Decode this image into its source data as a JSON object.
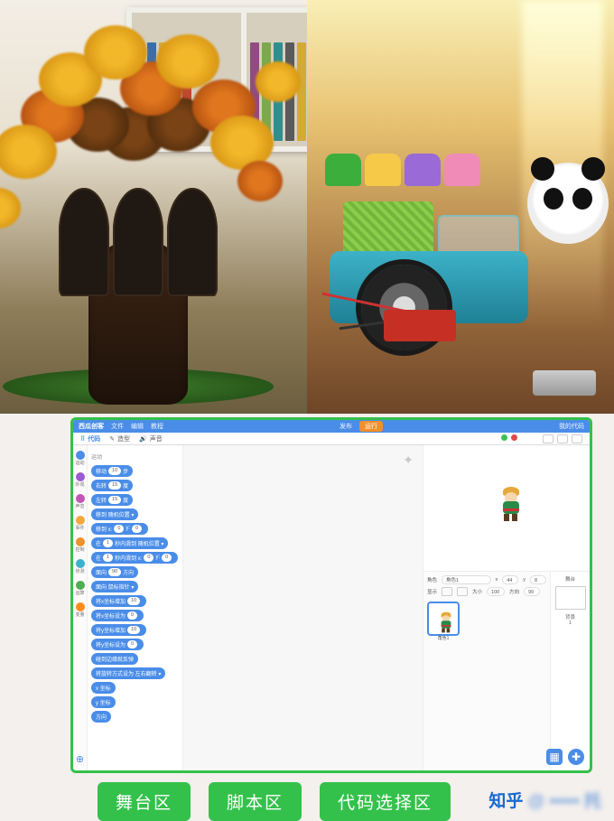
{
  "labels": {
    "stage": "舞台区",
    "script": "脚本区",
    "palette": "代码选择区"
  },
  "watermark": "知乎",
  "ide": {
    "brand": "西瓜创客",
    "menu": {
      "file": "文件",
      "edit": "编辑",
      "tutorial": "教程"
    },
    "topbar": {
      "run": "运行",
      "share": "发布",
      "mycode": "我的代码"
    },
    "tabs": {
      "code": "代码",
      "costumes": "造型",
      "sounds": "声音"
    },
    "categories": {
      "motion": {
        "label": "运动",
        "color": "#4a8de8"
      },
      "looks": {
        "label": "外观",
        "color": "#9b59d6"
      },
      "sound": {
        "label": "声音",
        "color": "#c355b7"
      },
      "events": {
        "label": "事件",
        "color": "#f2a93b"
      },
      "control": {
        "label": "控制",
        "color": "#f0902a"
      },
      "sensing": {
        "label": "侦测",
        "color": "#3bb2d0"
      },
      "operators": {
        "label": "运算",
        "color": "#4caf50"
      },
      "variables": {
        "label": "变量",
        "color": "#ff8c1a"
      }
    },
    "palette_header": "运动",
    "blocks": [
      {
        "cls": "c-mo",
        "text": "移动",
        "slot": "10",
        "tail": "步"
      },
      {
        "cls": "c-mo",
        "text": "右转",
        "slot": "15",
        "tail": "度"
      },
      {
        "cls": "c-mo",
        "text": "左转",
        "slot": "15",
        "tail": "度"
      },
      {
        "cls": "c-mo",
        "text": "移到 随机位置 ▾"
      },
      {
        "cls": "c-mo",
        "text": "移到 x:",
        "slot": "0",
        "mid": " y:",
        "slot2": "0"
      },
      {
        "cls": "c-mo",
        "text": "在",
        "slot": "1",
        "mid": "秒内滑到 随机位置 ▾"
      },
      {
        "cls": "c-mo",
        "text": "在",
        "slot": "1",
        "mid": "秒内滑到 x:",
        "slot2": "0",
        "mid2": " y:",
        "slot3": "0"
      },
      {
        "cls": "c-mo",
        "text": "面向",
        "slot": "90",
        "tail": "方向"
      },
      {
        "cls": "c-mo",
        "text": "面向 鼠标指针 ▾"
      },
      {
        "cls": "c-mo",
        "text": "将x坐标增加",
        "slot": "10"
      },
      {
        "cls": "c-mo",
        "text": "将x坐标设为",
        "slot": "0"
      },
      {
        "cls": "c-mo",
        "text": "将y坐标增加",
        "slot": "10"
      },
      {
        "cls": "c-mo",
        "text": "将y坐标设为",
        "slot": "0"
      },
      {
        "cls": "c-mo",
        "text": "碰到边缘就反弹"
      },
      {
        "cls": "c-mo",
        "text": "将旋转方式设为 左右翻转 ▾"
      },
      {
        "cls": "c-mo",
        "text": "x 坐标",
        "round": true
      },
      {
        "cls": "c-mo",
        "text": "y 坐标",
        "round": true
      },
      {
        "cls": "c-mo",
        "text": "方向",
        "round": true
      }
    ],
    "sprite_panel": {
      "name_label": "角色",
      "name_value": "角色1",
      "x_label": "x",
      "x_value": "44",
      "y_label": "y",
      "y_value": "8",
      "show_label": "显示",
      "size_label": "大小",
      "size_value": "100",
      "dir_label": "方向",
      "dir_value": "90",
      "thumb_label": "角色1",
      "stage_label": "舞台",
      "backdrop_label": "背景",
      "backdrop_count": "1"
    },
    "canvas_watermark": "✦"
  }
}
